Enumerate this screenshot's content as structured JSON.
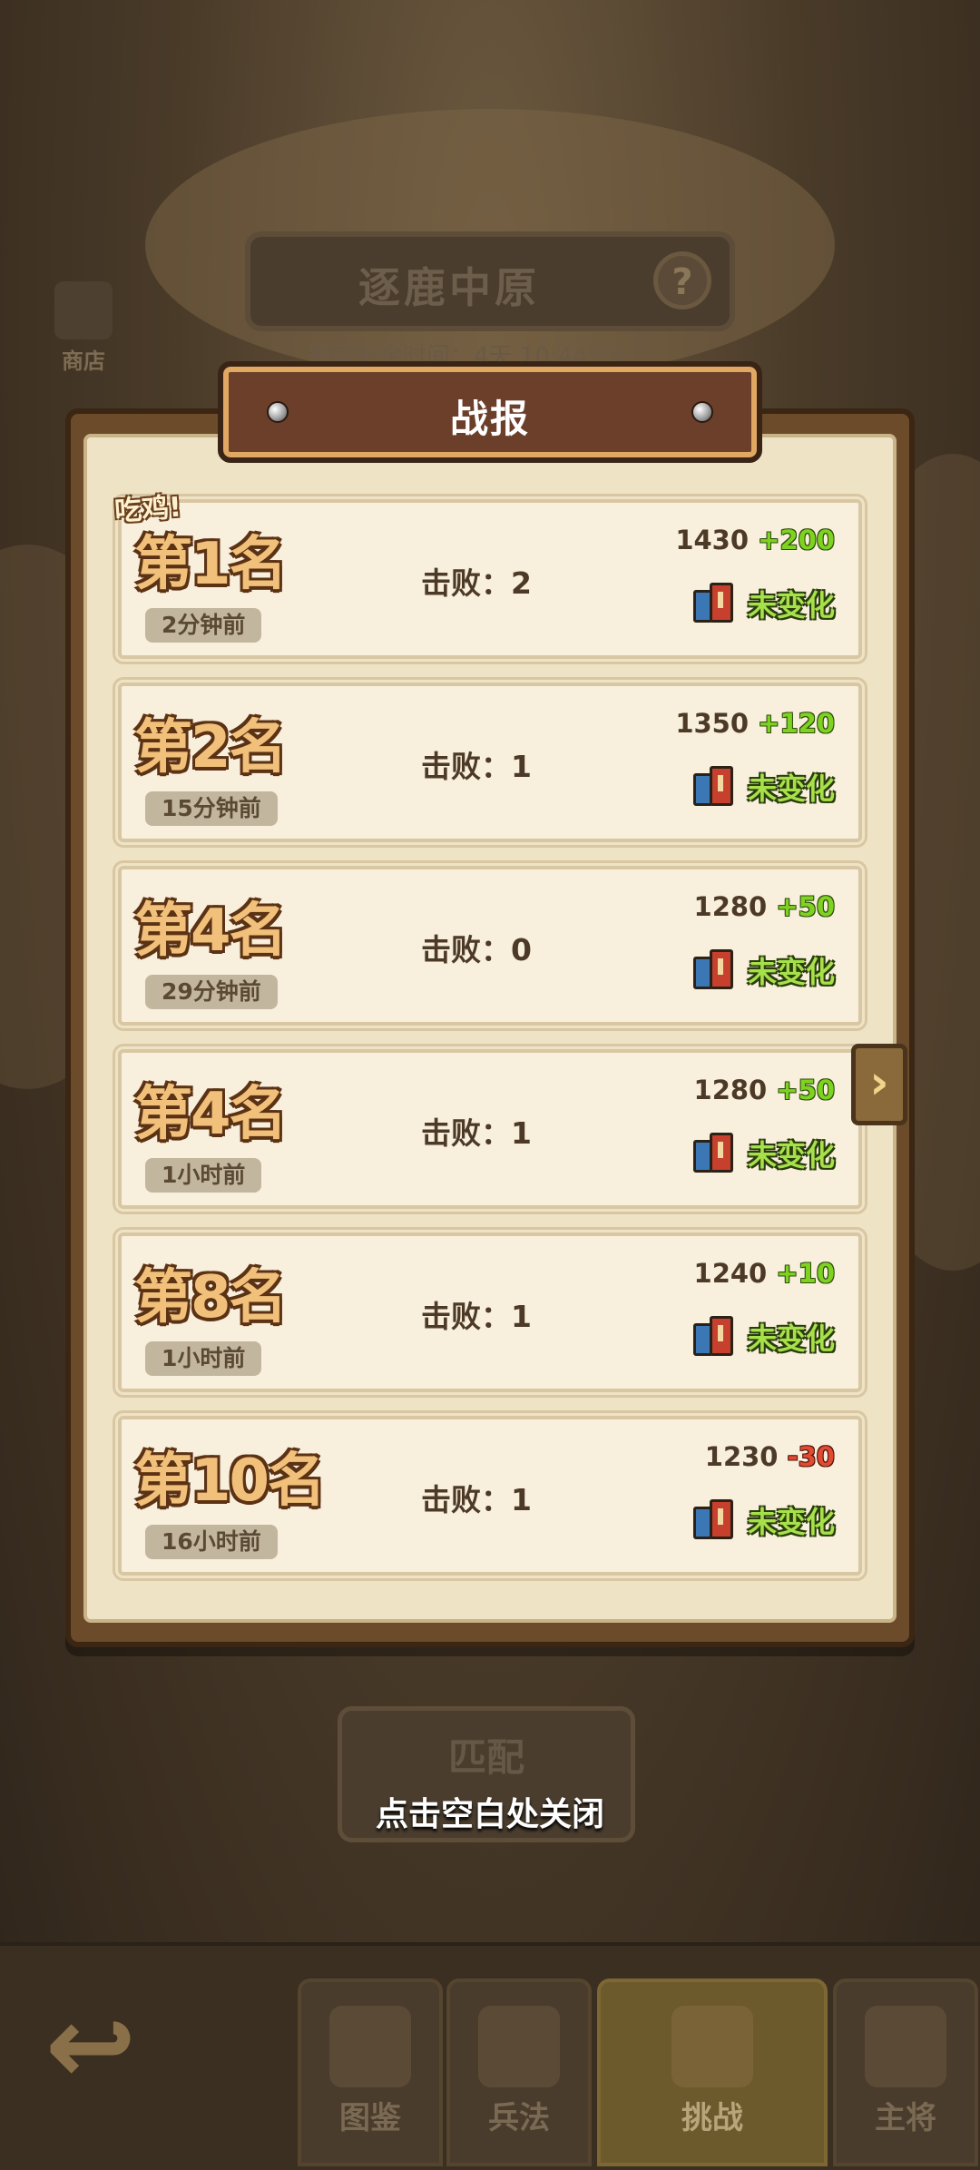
{
  "background": {
    "mode_title": "逐鹿中原",
    "help_label": "?",
    "season_text": "赛季剩余时间：4天 10:44:14",
    "shop_label": "商店",
    "side_arrow": "›",
    "match_button": "匹配",
    "back_arrow": "↩"
  },
  "popup": {
    "title": "战报",
    "chicken_label": "吃鸡!",
    "close_hint": "点击空白处关闭",
    "records": [
      {
        "rank": "第1名",
        "time": "2分钟前",
        "kills": "击败：2",
        "score": "1430",
        "delta": "+200",
        "status": "未变化"
      },
      {
        "rank": "第2名",
        "time": "15分钟前",
        "kills": "击败：1",
        "score": "1350",
        "delta": "+120",
        "status": "未变化"
      },
      {
        "rank": "第4名",
        "time": "29分钟前",
        "kills": "击败：0",
        "score": "1280",
        "delta": "+50",
        "status": "未变化"
      },
      {
        "rank": "第4名",
        "time": "1小时前",
        "kills": "击败：1",
        "score": "1280",
        "delta": "+50",
        "status": "未变化"
      },
      {
        "rank": "第8名",
        "time": "1小时前",
        "kills": "击败：1",
        "score": "1240",
        "delta": "+10",
        "status": "未变化"
      },
      {
        "rank": "第10名",
        "time": "16小时前",
        "kills": "击败：1",
        "score": "1230",
        "delta": "-30",
        "status": "未变化"
      }
    ]
  },
  "bottom_nav": {
    "tabs": [
      {
        "label": "图鉴",
        "icon": "building-icon",
        "active": false
      },
      {
        "label": "兵法",
        "icon": "scroll-icon",
        "active": false
      },
      {
        "label": "挑战",
        "icon": "crossed-swords-icon",
        "active": true
      },
      {
        "label": "主将",
        "icon": "general-icon",
        "active": false
      }
    ]
  },
  "colors": {
    "delta_positive": "#7ed321",
    "delta_negative": "#e24a32",
    "status": "#a6e04a",
    "rank_fill": "#f1c07a",
    "header_bg": "#6c3f2b"
  }
}
